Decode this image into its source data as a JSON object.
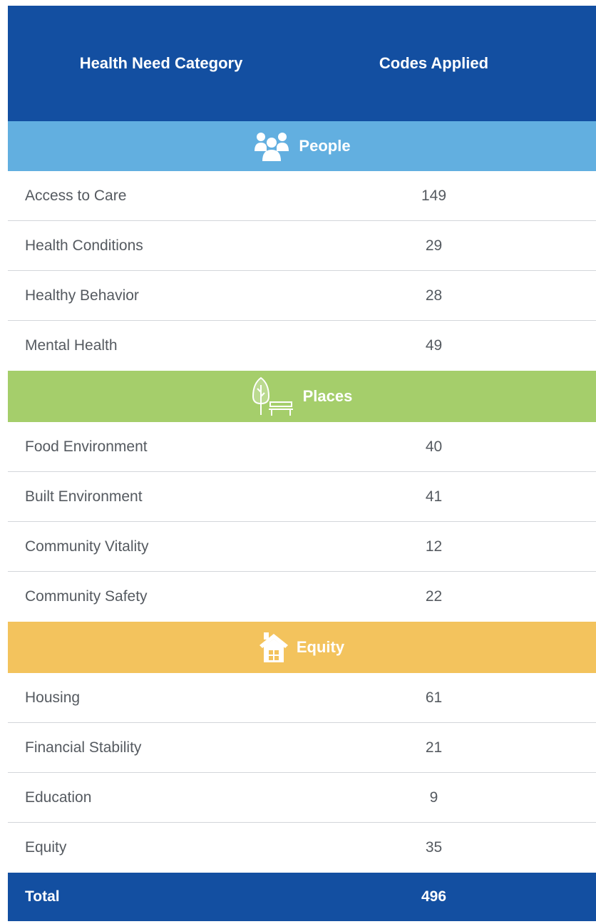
{
  "header": {
    "col1": "Health Need Category",
    "col2": "Codes Applied"
  },
  "colors": {
    "header": "#134fa1",
    "people": "#62afe0",
    "places": "#a5ce6b",
    "equity": "#f3c35d"
  },
  "sections": [
    {
      "label": "People",
      "icon": "people-group-icon",
      "rows": [
        {
          "name": "Access to Care",
          "value": "149"
        },
        {
          "name": "Health Conditions",
          "value": "29"
        },
        {
          "name": "Healthy Behavior",
          "value": "28"
        },
        {
          "name": "Mental Health",
          "value": "49"
        }
      ]
    },
    {
      "label": "Places",
      "icon": "tree-bench-icon",
      "rows": [
        {
          "name": "Food Environment",
          "value": "40"
        },
        {
          "name": "Built Environment",
          "value": "41"
        },
        {
          "name": "Community Vitality",
          "value": "12"
        },
        {
          "name": "Community Safety",
          "value": "22"
        }
      ]
    },
    {
      "label": "Equity",
      "icon": "house-icon",
      "rows": [
        {
          "name": "Housing",
          "value": "61"
        },
        {
          "name": "Financial Stability",
          "value": "21"
        },
        {
          "name": "Education",
          "value": "9"
        },
        {
          "name": "Equity",
          "value": "35"
        }
      ]
    }
  ],
  "total": {
    "label": "Total",
    "value": "496"
  }
}
